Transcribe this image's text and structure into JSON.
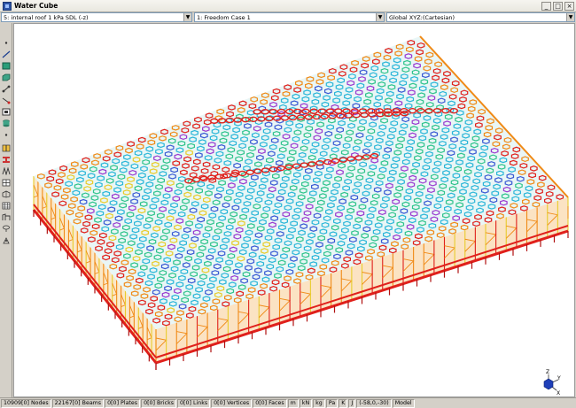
{
  "window": {
    "title": "Water Cube"
  },
  "combos": {
    "load_case": "5: internal roof 1 kPa SDL (-z)",
    "freedom_case": "1: Freedom Case 1",
    "coordinate_system": "Global XYZ:(Cartesian)"
  },
  "toolbar_icons": [
    "dot-icon",
    "line-icon",
    "plate-icon",
    "brick-icon",
    "link-icon",
    "vertex-icon",
    "face-icon",
    "cylinder-icon",
    "small-dot-icon",
    "beam-cross-section-icon",
    "beam-property-icon",
    "truss-icon",
    "grid-icon",
    "mesh-icon",
    "frame-icon",
    "shell-icon",
    "load-icon"
  ],
  "status": {
    "nodes": "10909[0] Nodes",
    "beams": "22167[0] Beams",
    "plates": "0[0] Plates",
    "bricks": "0[0] Bricks",
    "links": "0[0] Links",
    "vertices": "0[0] Vertices",
    "faces": "0[0] Faces",
    "unit_length": "m",
    "unit_force": "kN",
    "unit_mass": "kg",
    "unit_pressure": "Pa",
    "unit_temp": "K",
    "unit_energy": "J",
    "coords": "(-58,0,-30)",
    "mode": "Model"
  },
  "triad": {
    "z": "Z",
    "y": "Y",
    "x": "X"
  },
  "palette": {
    "red": "#e0201b",
    "orange": "#f08a16",
    "yellow": "#e8cc2c",
    "green": "#2fc48c",
    "cyan": "#2ab6d8",
    "blue": "#3a5ad4",
    "purple": "#9a3ad0"
  }
}
